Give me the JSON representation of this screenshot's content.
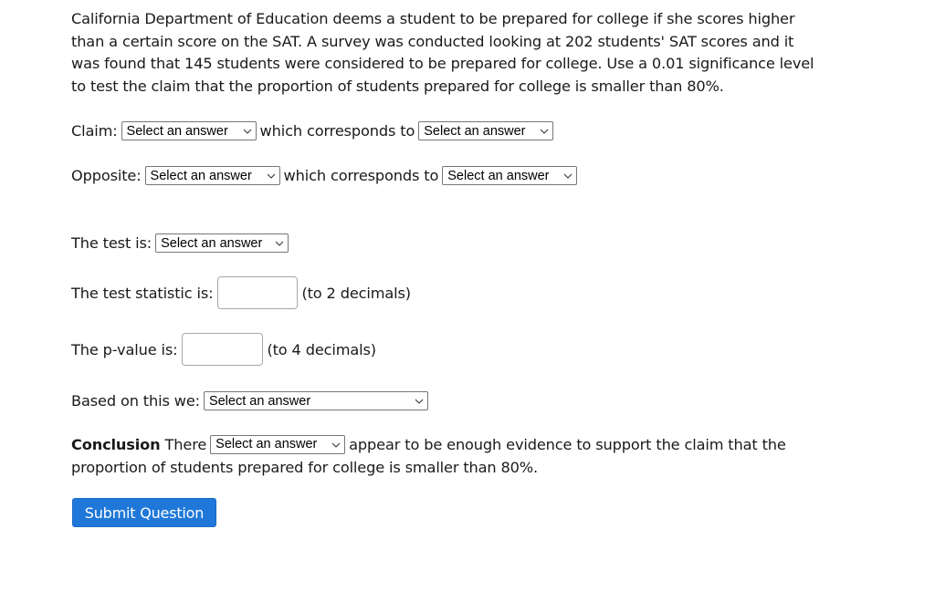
{
  "question": {
    "intro": "California Department of Education deems a student to be prepared for college if she scores higher than a certain score on the SAT. A survey was conducted looking at 202 students' SAT scores and it was found that 145 students were considered to be prepared for college. Use a 0.01 significance level to test the claim that the proportion of students prepared for college is smaller than 80%."
  },
  "claim": {
    "label": "Claim:",
    "select1": "Select an answer",
    "connector": "which corresponds to",
    "select2": "Select an answer"
  },
  "opposite": {
    "label": "Opposite:",
    "select1": "Select an answer",
    "connector": "which corresponds to",
    "select2": "Select an answer"
  },
  "test": {
    "label": "The test is:",
    "select": "Select an answer"
  },
  "test_statistic": {
    "label": "The test statistic is:",
    "value": "",
    "hint": "(to 2 decimals)"
  },
  "p_value": {
    "label": "The p-value is:",
    "value": "",
    "hint": "(to 4 decimals)"
  },
  "decision": {
    "label": "Based on this we:",
    "select": "Select an answer"
  },
  "conclusion": {
    "bold_label": "Conclusion",
    "before": "There",
    "select": "Select an answer",
    "after": "appear to be enough evidence to support the claim that the proportion of students prepared for college is smaller than 80%."
  },
  "submit": {
    "label": "Submit Question"
  }
}
